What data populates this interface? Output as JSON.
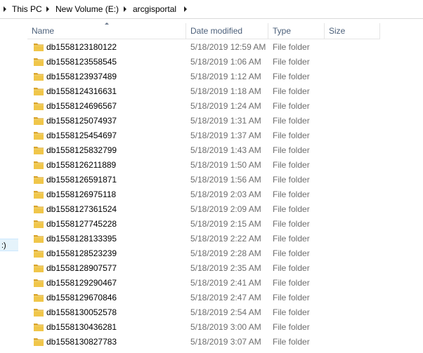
{
  "breadcrumb": {
    "items": [
      "This PC",
      "New Volume (E:)",
      "arcgisportal"
    ]
  },
  "nav": {
    "selected_label": ":)"
  },
  "columns": {
    "name": "Name",
    "date": "Date modified",
    "type": "Type",
    "size": "Size"
  },
  "icons": {
    "row_icon": "folder-icon",
    "separator": "chevron-right-icon"
  },
  "colors": {
    "folder_yellow": "#e8b93c",
    "header_text": "#4c607a",
    "meta_text": "#6d6d6d"
  },
  "rows": [
    {
      "name": "db1558123180122",
      "date": "5/18/2019 12:59 AM",
      "type": "File folder",
      "size": ""
    },
    {
      "name": "db1558123558545",
      "date": "5/18/2019 1:06 AM",
      "type": "File folder",
      "size": ""
    },
    {
      "name": "db1558123937489",
      "date": "5/18/2019 1:12 AM",
      "type": "File folder",
      "size": ""
    },
    {
      "name": "db1558124316631",
      "date": "5/18/2019 1:18 AM",
      "type": "File folder",
      "size": ""
    },
    {
      "name": "db1558124696567",
      "date": "5/18/2019 1:24 AM",
      "type": "File folder",
      "size": ""
    },
    {
      "name": "db1558125074937",
      "date": "5/18/2019 1:31 AM",
      "type": "File folder",
      "size": ""
    },
    {
      "name": "db1558125454697",
      "date": "5/18/2019 1:37 AM",
      "type": "File folder",
      "size": ""
    },
    {
      "name": "db1558125832799",
      "date": "5/18/2019 1:43 AM",
      "type": "File folder",
      "size": ""
    },
    {
      "name": "db1558126211889",
      "date": "5/18/2019 1:50 AM",
      "type": "File folder",
      "size": ""
    },
    {
      "name": "db1558126591871",
      "date": "5/18/2019 1:56 AM",
      "type": "File folder",
      "size": ""
    },
    {
      "name": "db1558126975118",
      "date": "5/18/2019 2:03 AM",
      "type": "File folder",
      "size": ""
    },
    {
      "name": "db1558127361524",
      "date": "5/18/2019 2:09 AM",
      "type": "File folder",
      "size": ""
    },
    {
      "name": "db1558127745228",
      "date": "5/18/2019 2:15 AM",
      "type": "File folder",
      "size": ""
    },
    {
      "name": "db1558128133395",
      "date": "5/18/2019 2:22 AM",
      "type": "File folder",
      "size": ""
    },
    {
      "name": "db1558128523239",
      "date": "5/18/2019 2:28 AM",
      "type": "File folder",
      "size": ""
    },
    {
      "name": "db1558128907577",
      "date": "5/18/2019 2:35 AM",
      "type": "File folder",
      "size": ""
    },
    {
      "name": "db1558129290467",
      "date": "5/18/2019 2:41 AM",
      "type": "File folder",
      "size": ""
    },
    {
      "name": "db1558129670846",
      "date": "5/18/2019 2:47 AM",
      "type": "File folder",
      "size": ""
    },
    {
      "name": "db1558130052578",
      "date": "5/18/2019 2:54 AM",
      "type": "File folder",
      "size": ""
    },
    {
      "name": "db1558130436281",
      "date": "5/18/2019 3:00 AM",
      "type": "File folder",
      "size": ""
    },
    {
      "name": "db1558130827783",
      "date": "5/18/2019 3:07 AM",
      "type": "File folder",
      "size": ""
    }
  ]
}
